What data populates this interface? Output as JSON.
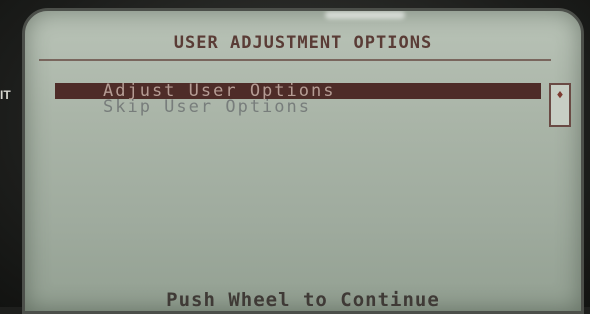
{
  "device": {
    "side_label": "IT"
  },
  "screen": {
    "title": "USER ADJUSTMENT OPTIONS",
    "menu": [
      {
        "label": "Adjust User Options",
        "selected": true
      },
      {
        "label": "Skip User Options",
        "selected": false
      }
    ],
    "scroll_indicator": "♦",
    "footer": "Push Wheel to Continue"
  },
  "colors": {
    "lcd_background": "#aab5a8",
    "highlight": "#4e2c28",
    "text": "#5a3c36"
  }
}
